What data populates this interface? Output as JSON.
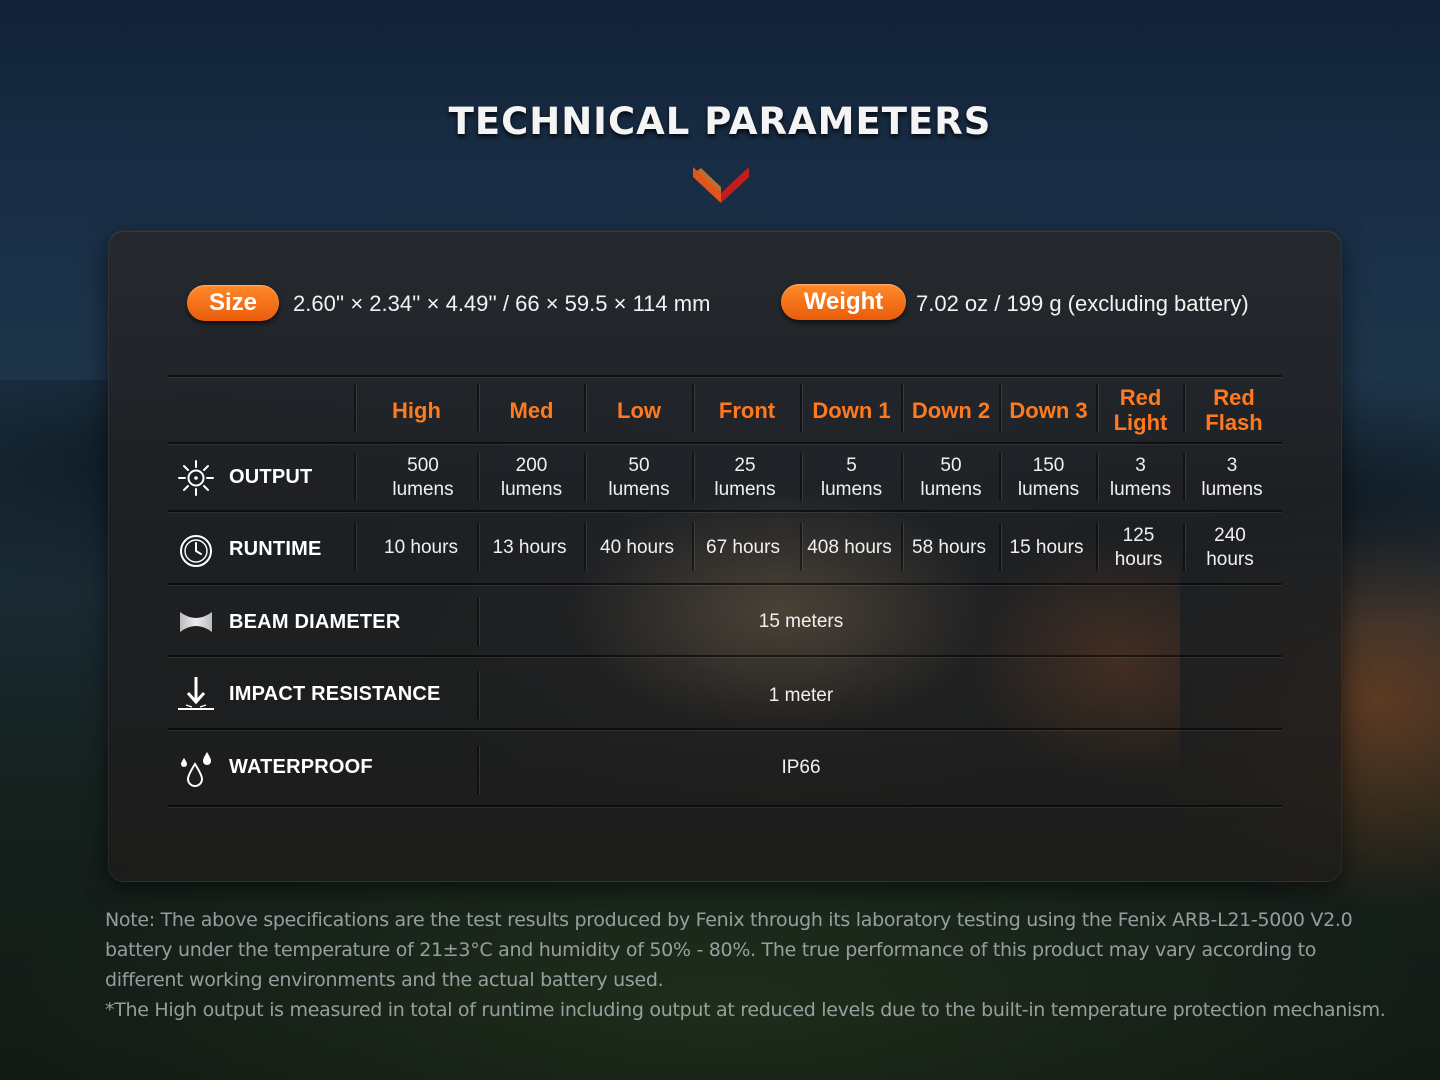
{
  "title": "TECHNICAL PARAMETERS",
  "accent_color": "#ff7a1f",
  "specs": {
    "size_label": "Size",
    "size_value": "2.60'' × 2.34'' × 4.49'' / 66 × 59.5 × 114 mm",
    "weight_label": "Weight",
    "weight_value": "7.02 oz / 199 g (excluding battery)"
  },
  "table": {
    "columns": [
      "High",
      "Med",
      "Low",
      "Front",
      "Down 1",
      "Down 2",
      "Down 3",
      "Red\nLight",
      "Red\nFlash"
    ],
    "rows": {
      "output": {
        "label": "OUTPUT",
        "icon": "sun-icon",
        "values": [
          "500\nlumens",
          "200\nlumens",
          "50\nlumens",
          "25\nlumens",
          "5\nlumens",
          "50\nlumens",
          "150\nlumens",
          "3\nlumens",
          "3\nlumens"
        ]
      },
      "runtime": {
        "label": "RUNTIME",
        "icon": "clock-icon",
        "values": [
          "10 hours",
          "13 hours",
          "40 hours",
          "67 hours",
          "408 hours",
          "58 hours",
          "15 hours",
          "125\nhours",
          "240\nhours"
        ]
      },
      "beam": {
        "label": "BEAM DIAMETER",
        "icon": "beam-icon",
        "value": "15 meters"
      },
      "impact": {
        "label": "IMPACT RESISTANCE",
        "icon": "impact-arrow-icon",
        "value": "1 meter"
      },
      "waterproof": {
        "label": "WATERPROOF",
        "icon": "water-drops-icon",
        "value": "IP66"
      }
    }
  },
  "notes": [
    "Note: The above specifications are the test results produced by Fenix through its laboratory testing using the Fenix ARB-L21-5000 V2.0 battery under the temperature of 21±3°C and humidity of 50% - 80%. The true performance of this product may vary according to different working environments and the actual battery used.",
    "*The High output is measured in total of runtime including output at reduced levels due to the built-in temperature protection mechanism."
  ]
}
